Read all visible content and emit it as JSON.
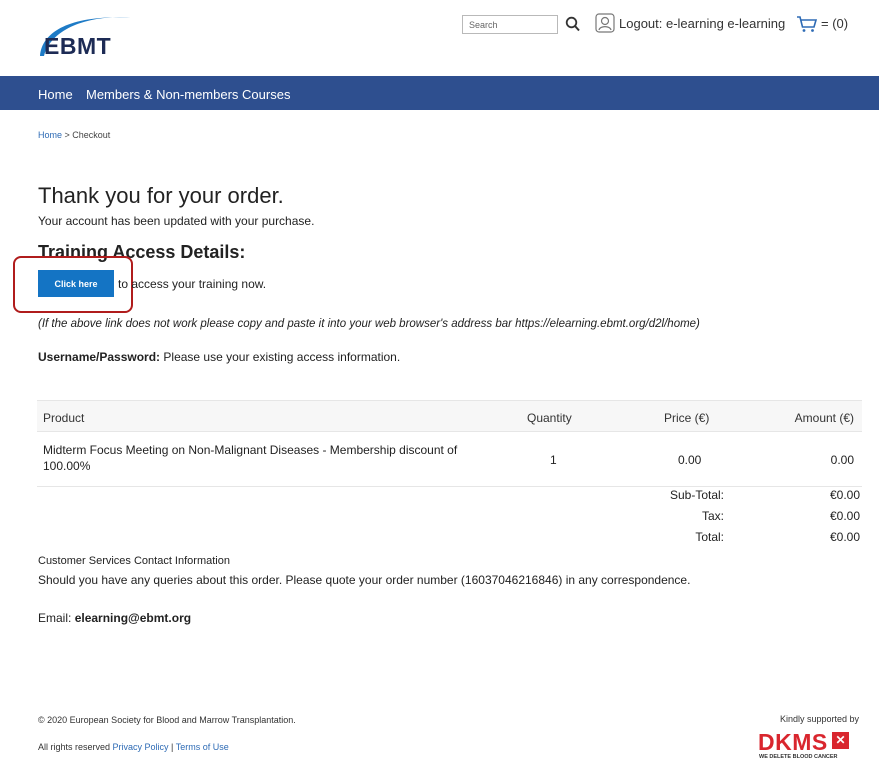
{
  "header": {
    "logo_text": "EBMT",
    "search_placeholder": "Search",
    "logout_label": "Logout: e-learning e-learning",
    "cart_label": "= (0)"
  },
  "nav": {
    "home": "Home",
    "courses": "Members & Non-members Courses"
  },
  "breadcrumb": {
    "home": "Home",
    "separator": " > ",
    "current": "Checkout"
  },
  "confirmation": {
    "title": "Thank you for your order.",
    "account_updated": "Your account has been updated with your purchase.",
    "access_heading": "Training Access Details:",
    "click_here_label": "Click here",
    "access_text": "to access your training now.",
    "note": "(If the above link does not work please copy and paste it into your web browser's address bar https://elearning.ebmt.org/d2l/home)",
    "credentials_label": "Username/Password:",
    "credentials_text": " Please use your existing access information."
  },
  "order_table": {
    "headers": {
      "product": "Product",
      "quantity": "Quantity",
      "price": "Price (€)",
      "amount": "Amount (€)"
    },
    "rows": [
      {
        "product": "Midterm Focus Meeting on Non-Malignant Diseases - Membership discount of 100.00%",
        "quantity": "1",
        "price": "0.00",
        "amount": "0.00"
      }
    ],
    "subtotal_label": "Sub-Total:",
    "subtotal_value": "€0.00",
    "tax_label": "Tax:",
    "tax_value": "€0.00",
    "total_label": "Total:",
    "total_value": "€0.00"
  },
  "customer_service": {
    "heading": "Customer Services Contact Information",
    "text": "Should you have any queries about this order. Please quote your order number (16037046216846) in any correspondence.",
    "email_label": "Email: ",
    "email": "elearning@ebmt.org"
  },
  "footer": {
    "copyright": "© 2020 European Society for Blood and Marrow Transplantation.",
    "rights": "All rights reserved ",
    "privacy": "Privacy Policy",
    "separator": " | ",
    "terms": "Terms of Use",
    "supported_by": "Kindly supported by",
    "dkms_word": "DKMS",
    "dkms_tagline": "WE DELETE BLOOD CANCER"
  },
  "colors": {
    "nav_background": "#2e4f8f",
    "button": "#1474c4",
    "highlight": "#b01c1c",
    "dkms_red": "#d9262e"
  }
}
